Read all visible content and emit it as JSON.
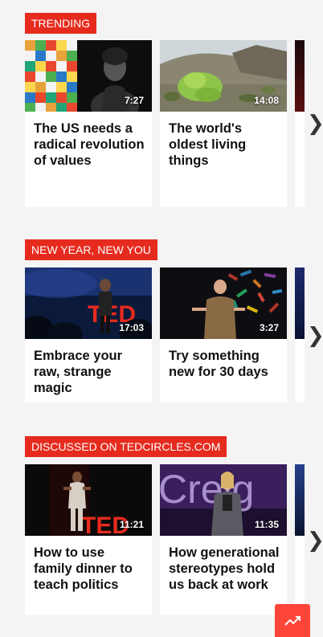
{
  "sections": [
    {
      "label": "TRENDING",
      "cards": [
        {
          "title": "The US needs a radical revolution of values",
          "duration": "7:27"
        },
        {
          "title": "The world's oldest living things",
          "duration": "14:08"
        }
      ]
    },
    {
      "label": "NEW YEAR, NEW YOU",
      "cards": [
        {
          "title": "Embrace your raw, strange magic",
          "duration": "17:03"
        },
        {
          "title": "Try something new for 30 days",
          "duration": "3:27"
        }
      ]
    },
    {
      "label": "DISCUSSED ON TEDCIRCLES.COM",
      "cards": [
        {
          "title": "How to use family dinner to teach politics",
          "duration": "11:21"
        },
        {
          "title": "How generational stereotypes hold us back at work",
          "duration": "11:35"
        }
      ]
    }
  ],
  "icons": {
    "next": "chevron-right-icon",
    "trending": "trending-up-icon"
  },
  "colors": {
    "accent": "#e62b1e",
    "fab": "#ff4438",
    "background": "#f4f4f4"
  }
}
